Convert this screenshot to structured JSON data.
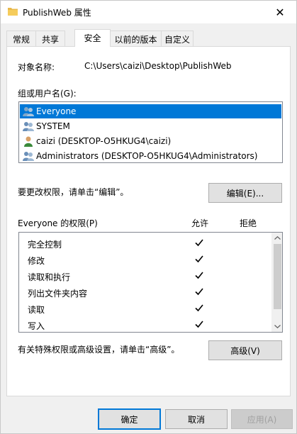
{
  "window": {
    "title": "PublishWeb 属性",
    "close_symbol": "✕"
  },
  "tabs": [
    {
      "label": "常规"
    },
    {
      "label": "共享"
    },
    {
      "label": "安全"
    },
    {
      "label": "以前的版本"
    },
    {
      "label": "自定义"
    }
  ],
  "active_tab": "安全",
  "object": {
    "label": "对象名称:",
    "value": "C:\\Users\\caizi\\Desktop\\PublishWeb"
  },
  "groups": {
    "label": "组或用户名(G):",
    "items": [
      {
        "name": "Everyone",
        "icon": "group-icon",
        "selected": true
      },
      {
        "name": "SYSTEM",
        "icon": "group-icon",
        "selected": false
      },
      {
        "name": "caizi (DESKTOP-O5HKUG4\\caizi)",
        "icon": "user-icon",
        "selected": false
      },
      {
        "name": "Administrators (DESKTOP-O5HKUG4\\Administrators)",
        "icon": "group-icon",
        "selected": false
      }
    ]
  },
  "change_note": "要更改权限，请单击“编辑”。",
  "edit_button": "编辑(E)...",
  "permissions": {
    "title": "Everyone 的权限(P)",
    "allow_header": "允许",
    "deny_header": "拒绝",
    "rows": [
      {
        "name": "完全控制",
        "allow": true,
        "deny": false
      },
      {
        "name": "修改",
        "allow": true,
        "deny": false
      },
      {
        "name": "读取和执行",
        "allow": true,
        "deny": false
      },
      {
        "name": "列出文件夹内容",
        "allow": true,
        "deny": false
      },
      {
        "name": "读取",
        "allow": true,
        "deny": false
      },
      {
        "name": "写入",
        "allow": true,
        "deny": false
      }
    ]
  },
  "advanced_note": "有关特殊权限或高级设置，请单击“高级”。",
  "advanced_button": "高级(V)",
  "footer": {
    "ok": "确定",
    "cancel": "取消",
    "apply": "应用(A)"
  },
  "colors": {
    "selection": "#0078d7",
    "window_bg": "#f0f0f0",
    "panel_bg": "#ffffff"
  }
}
